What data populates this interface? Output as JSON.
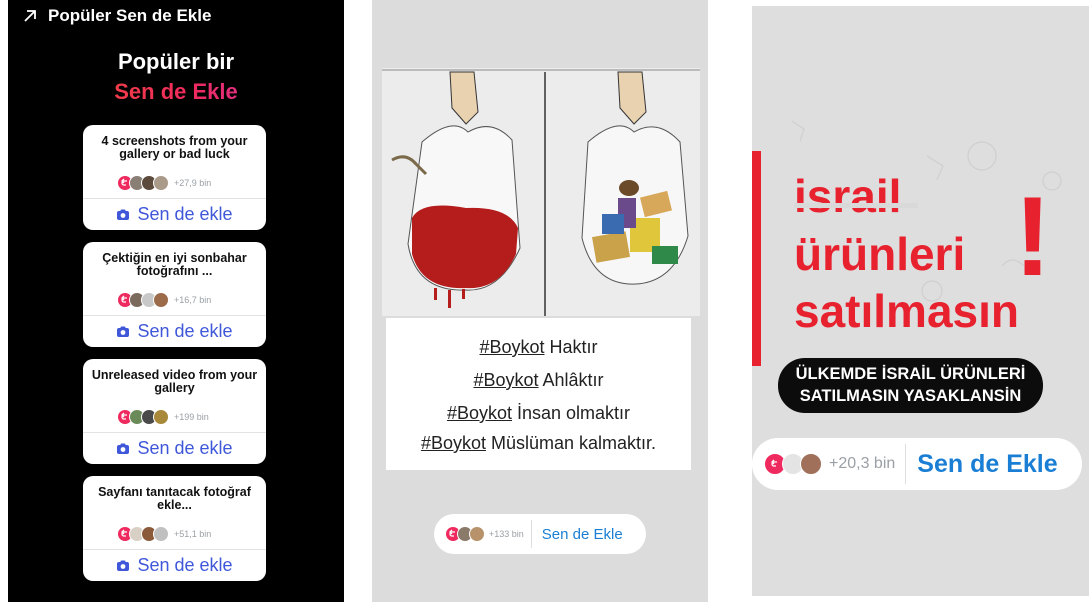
{
  "panel1": {
    "header_title": "Popüler Sen de Ekle",
    "heading_line1": "Popüler bir",
    "heading_line2": "Sen de Ekle",
    "cards": [
      {
        "title": "4 screenshots from your gallery or bad luck",
        "count": "+27,9 bin",
        "button": "Sen de ekle"
      },
      {
        "title": "Çektiğin en iyi sonbahar fotoğrafını ...",
        "count": "+16,7 bin",
        "button": "Sen de ekle"
      },
      {
        "title": "Unreleased video from your gallery",
        "count": "+199 bin",
        "button": "Sen de ekle"
      },
      {
        "title": "Sayfanı tanıtacak fotoğraf ekle...",
        "count": "+51,1 bin",
        "button": "Sen de ekle"
      }
    ]
  },
  "panel2": {
    "lines": [
      {
        "tag": "#Boykot",
        "rest": " Haktır"
      },
      {
        "tag": "#Boykot",
        "rest": " Ahlâktır"
      },
      {
        "tag": "#Boykot",
        "rest": " İnsan olmaktır"
      },
      {
        "tag": "#Boykot",
        "rest": " Müslüman kalmaktır."
      }
    ],
    "sticker": {
      "count": "+133 bin",
      "label": "Sen de Ekle"
    }
  },
  "panel3": {
    "big_line1": "israil",
    "big_line2": "ürünleri",
    "big_line3": "satılmasın",
    "exclamation": "!",
    "banner_line1": "ÜLKEMDE İSRAİL ÜRÜNLERİ",
    "banner_line2": "SATILMASIN YASAKLANSİN",
    "sticker": {
      "count": "+20,3 bin",
      "label": "Sen de Ekle"
    }
  },
  "colors": {
    "instagram_gradient": [
      "#f5542c",
      "#ee2a5e",
      "#c73bcb"
    ],
    "button_blue": "#3f57d9",
    "sticker_blue": "#1a7fd4",
    "boycott_red": "#e8212e"
  },
  "icons": [
    "arrow-up-right-icon",
    "camera-icon",
    "add-yours-icon"
  ]
}
